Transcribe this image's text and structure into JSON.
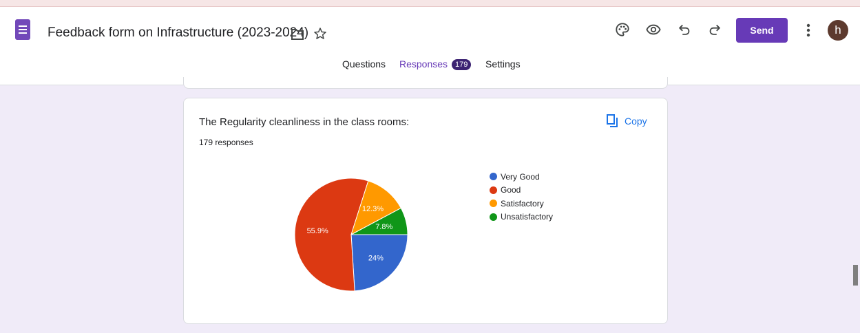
{
  "app": {
    "icon": "forms-icon",
    "brand_color": "#673ab7",
    "form_title": "Feedback form on Infrastructure (2023-2024)"
  },
  "toolbar": {
    "icons": [
      "palette-icon",
      "preview-eye-icon",
      "undo-icon",
      "redo-icon",
      "more-vert-icon"
    ],
    "send_label": "Send",
    "avatar_letter": "h"
  },
  "tabs": [
    {
      "label": "Questions",
      "active": false
    },
    {
      "label": "Responses",
      "active": true,
      "badge": "179"
    },
    {
      "label": "Settings",
      "active": false
    }
  ],
  "question": {
    "title": "The Regularity cleanliness in the class rooms:",
    "responses_text": "179 responses",
    "copy_label": "Copy"
  },
  "chart_data": {
    "type": "pie",
    "categories": [
      "Very Good",
      "Good",
      "Satisfactory",
      "Unsatisfactory"
    ],
    "values": [
      24,
      55.9,
      12.3,
      7.8
    ],
    "labels": [
      "24%",
      "55.9%",
      "12.3%",
      "7.8%"
    ],
    "colors": [
      "#3366cc",
      "#dc3912",
      "#ff9900",
      "#109618"
    ],
    "legend_position": "right"
  }
}
